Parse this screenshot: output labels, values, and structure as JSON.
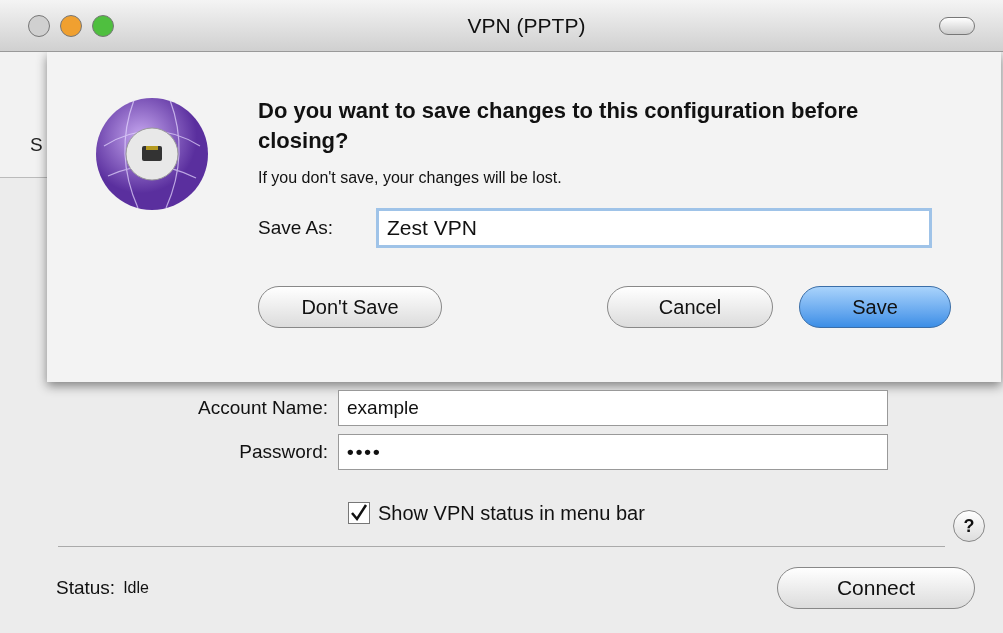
{
  "window": {
    "title": "VPN (PPTP)"
  },
  "toolbar_fragment": "S",
  "sheet": {
    "heading": "Do you want to save changes to this configuration before closing?",
    "message": "If you don't save, your changes will be lost.",
    "save_as": {
      "label": "Save As:",
      "value": "Zest VPN"
    },
    "buttons": [
      {
        "label": "Don't Save",
        "default": false
      },
      {
        "label": "Cancel",
        "default": false
      },
      {
        "label": "Save",
        "default": true
      }
    ]
  },
  "fields": [
    {
      "label": "Account Name:",
      "value": "example",
      "kind": "text"
    },
    {
      "label": "Password:",
      "value": "••••",
      "kind": "password"
    }
  ],
  "checkbox": {
    "label": "Show VPN status in menu bar",
    "checked": true
  },
  "help_button": "?",
  "status": {
    "label": "Status:",
    "value": "Idle"
  },
  "connect_button": "Connect"
}
